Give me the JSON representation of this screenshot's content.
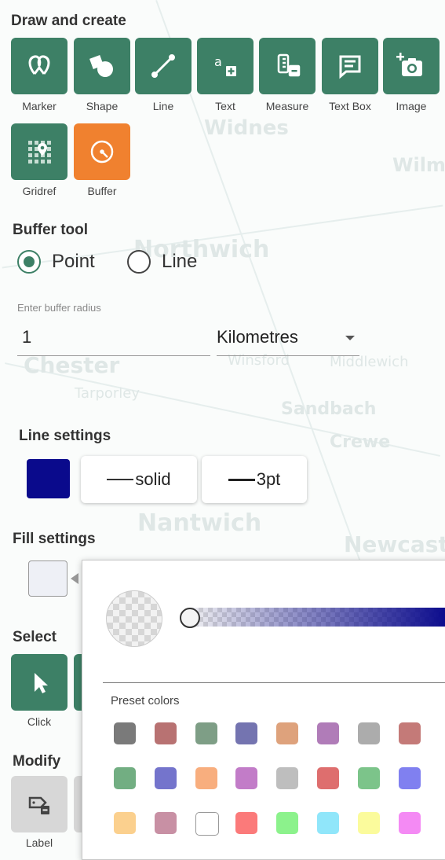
{
  "map": {
    "places": [
      "Widnes",
      "Northwich",
      "Winsford",
      "Middlewich",
      "Chester",
      "Tarporley",
      "Sandbach",
      "Crewe",
      "Nantwich",
      "Newcastle",
      "Wilmslow"
    ]
  },
  "draw": {
    "title": "Draw and create",
    "tools": [
      {
        "label": "Marker",
        "icon": "marker-icon"
      },
      {
        "label": "Shape",
        "icon": "shape-icon"
      },
      {
        "label": "Line",
        "icon": "line-icon"
      },
      {
        "label": "Text",
        "icon": "text-icon"
      },
      {
        "label": "Measure",
        "icon": "measure-icon"
      },
      {
        "label": "Text Box",
        "icon": "text-box-icon"
      },
      {
        "label": "Image",
        "icon": "image-icon"
      },
      {
        "label": "Gridref",
        "icon": "gridref-icon"
      },
      {
        "label": "Buffer",
        "icon": "buffer-icon",
        "active": true
      }
    ]
  },
  "buffer": {
    "title": "Buffer tool",
    "options": [
      {
        "label": "Point",
        "selected": true
      },
      {
        "label": "Line",
        "selected": false
      }
    ],
    "radius_label": "Enter buffer radius",
    "radius_value": "1",
    "unit": "Kilometres"
  },
  "line_settings": {
    "title": "Line settings",
    "color": "#0a0a8c",
    "style": "solid",
    "width": "3pt"
  },
  "fill_settings": {
    "title": "Fill settings",
    "color": "#eef0f6"
  },
  "select": {
    "title": "Select",
    "tools": [
      {
        "label": "Click",
        "icon": "cursor-icon"
      }
    ]
  },
  "modify": {
    "title": "Modify",
    "tools": [
      {
        "label": "Label",
        "icon": "label-icon"
      }
    ]
  },
  "color_picker": {
    "base_color": "#0a0a8c",
    "preset_title": "Preset colors",
    "presets": [
      "#7a7a7a",
      "#b87272",
      "#7e9e86",
      "#7474b0",
      "#dea27c",
      "#b07cb8",
      "#acacac",
      "#c47a78",
      "#72ae82",
      "#7474cc",
      "#f8ae7e",
      "#c27cc8",
      "#bebebe",
      "#de6e6e",
      "#7cc48a",
      "#8080f0",
      "#fbd08e",
      "#c890a4",
      "#ffffff",
      "#fb7a7a",
      "#8cf28c",
      "#90e6fa",
      "#fbfb9c",
      "#f48af4"
    ]
  }
}
